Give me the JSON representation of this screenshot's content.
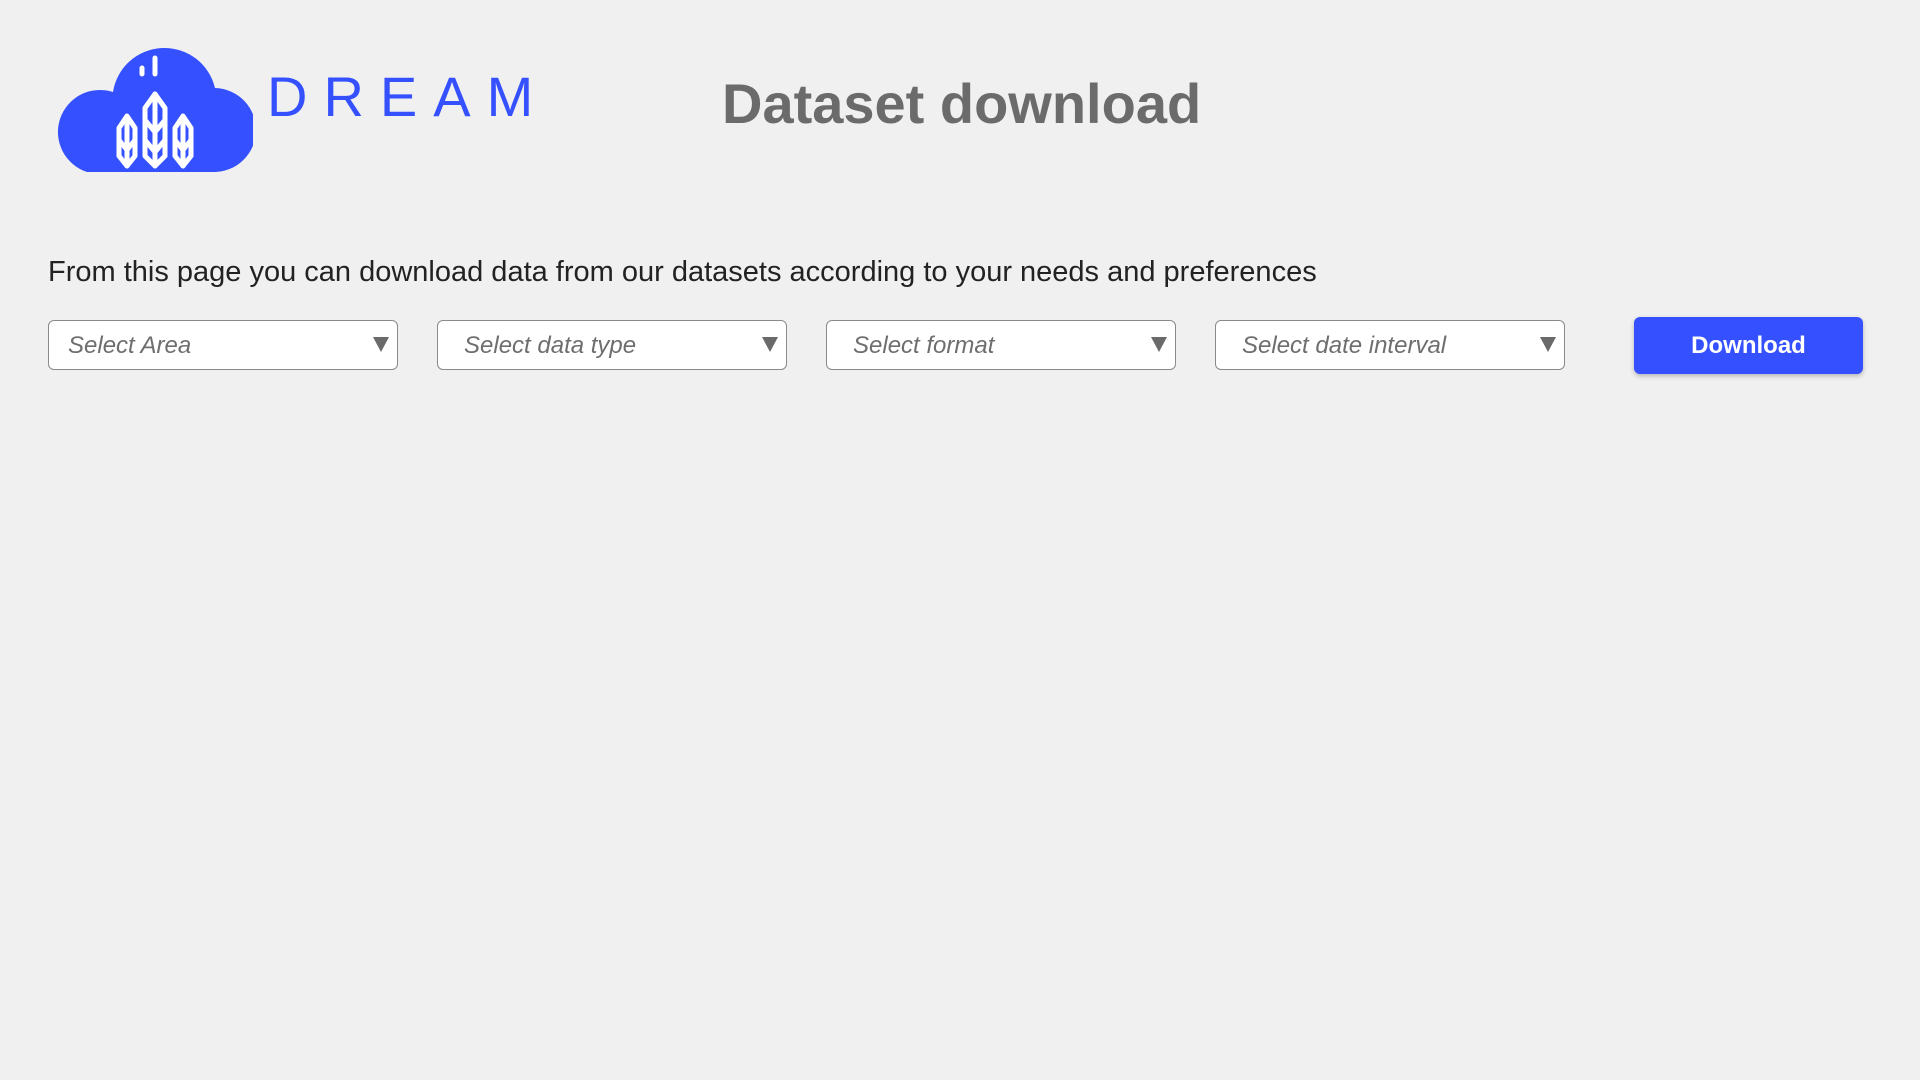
{
  "brand": {
    "name": "DREAM",
    "logo_icon": "cloud-wheat-icon",
    "color": "#3551ff"
  },
  "header": {
    "title": "Dataset download",
    "title_color": "#6b6b6b"
  },
  "intro": {
    "text": "From this page you can download data from our datasets according to your needs and preferences"
  },
  "filters": [
    {
      "placeholder": "Select Area",
      "icon": "chevron-down-icon"
    },
    {
      "placeholder": "Select data type",
      "icon": "chevron-down-icon"
    },
    {
      "placeholder": "Select format",
      "icon": "chevron-down-icon"
    },
    {
      "placeholder": "Select date interval",
      "icon": "chevron-down-icon"
    }
  ],
  "actions": {
    "download_label": "Download",
    "download_color": "#3551ff"
  }
}
